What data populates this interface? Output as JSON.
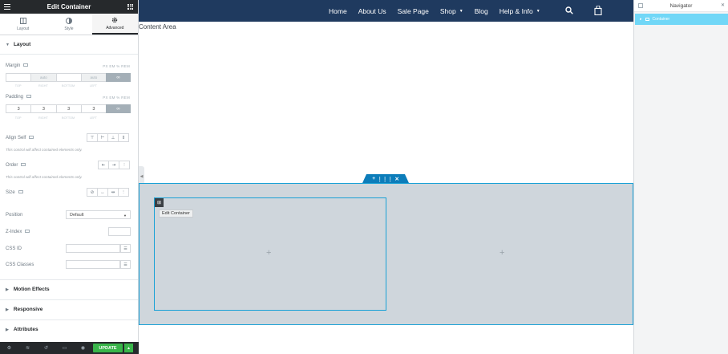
{
  "panel": {
    "title": "Edit Container",
    "tabs": [
      {
        "label": "Layout",
        "icon": "layout-icon"
      },
      {
        "label": "Style",
        "icon": "style-icon"
      },
      {
        "label": "Advanced",
        "icon": "gear-icon"
      }
    ],
    "section_layout": "Layout",
    "margin": {
      "label": "Margin",
      "units": "PX EM % REM",
      "values": [
        "",
        "auto",
        "",
        "auto"
      ],
      "sides": [
        "TOP",
        "RIGHT",
        "BOTTOM",
        "LEFT"
      ]
    },
    "padding": {
      "label": "Padding",
      "units": "PX EM % REM",
      "values": [
        "3",
        "3",
        "3",
        "3"
      ],
      "sides": [
        "TOP",
        "RIGHT",
        "BOTTOM",
        "LEFT"
      ]
    },
    "align_self": {
      "label": "Align Self",
      "note": "This control will affect contained elements only."
    },
    "order": {
      "label": "Order",
      "note": "This control will affect contained elements only."
    },
    "size": {
      "label": "Size"
    },
    "position": {
      "label": "Position",
      "value": "Default"
    },
    "z_index": {
      "label": "Z-Index"
    },
    "css_id": {
      "label": "CSS ID"
    },
    "css_classes": {
      "label": "CSS Classes"
    },
    "collapsed_sections": [
      "Motion Effects",
      "Responsive",
      "Attributes"
    ],
    "update_label": "UPDATE"
  },
  "site": {
    "nav": [
      "Home",
      "About Us",
      "Sale Page",
      "Shop",
      "Blog",
      "Help & Info"
    ],
    "content_title": "Content Area",
    "tooltip": "Edit Container"
  },
  "navigator": {
    "title": "Navigator",
    "items": [
      "Container"
    ]
  },
  "colors": {
    "header_bg": "#1f3a5f",
    "panel_dark": "#26292c",
    "accent_blue": "#1aa1d6",
    "update_green": "#39b54a",
    "navigator_selected": "#71d7f7"
  }
}
